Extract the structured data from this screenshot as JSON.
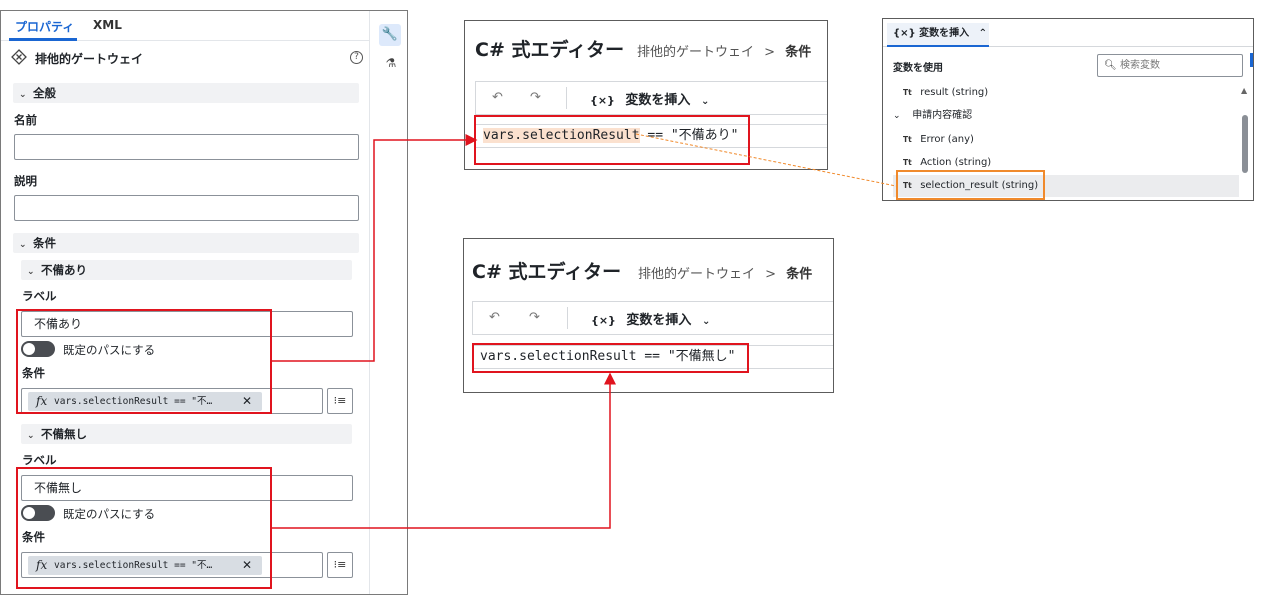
{
  "properties_panel": {
    "tabs": [
      "プロパティ",
      "XML"
    ],
    "gateway_title": "排他的ゲートウェイ",
    "help_icon": "question-circle-icon",
    "sections": {
      "general": "全般",
      "conditions": "条件"
    },
    "fields": {
      "name_label": "名前",
      "name_value": "",
      "description_label": "説明",
      "description_value": ""
    },
    "branches": [
      {
        "title": "不備あり",
        "label_caption": "ラベル",
        "label_value": "不備あり",
        "default_path_label": "既定のパスにする",
        "condition_caption": "条件",
        "condition_text": "vars.selectionResult == \"不…",
        "fx": "fx"
      },
      {
        "title": "不備無し",
        "label_caption": "ラベル",
        "label_value": "不備無し",
        "default_path_label": "既定のパスにする",
        "condition_caption": "条件",
        "condition_text": "vars.selectionResult == \"不…",
        "fx": "fx"
      }
    ],
    "side_icons": [
      "wrench-icon",
      "flask-icon"
    ]
  },
  "editor_top": {
    "title": "C# 式エディター",
    "breadcrumb_parent": "排他的ゲートウェイ",
    "breadcrumb_separator": ">",
    "breadcrumb_current": "条件",
    "insert_label": "変数を挿入",
    "insert_prefix": "{×}",
    "code_var": "vars.selectionResult",
    "code_rest": " == \"不備あり\""
  },
  "editor_bottom": {
    "title": "C# 式エディター",
    "breadcrumb_parent": "排他的ゲートウェイ",
    "breadcrumb_separator": ">",
    "breadcrumb_current": "条件",
    "insert_label": "変数を挿入",
    "insert_prefix": "{×}",
    "code": "vars.selectionResult == \"不備無し\""
  },
  "variable_picker": {
    "tab_label": "{×}  変数を挿入",
    "use_label": "変数を使用",
    "search_placeholder": "検索変数",
    "items": [
      {
        "type_badge": "Tt",
        "name": "result (string)"
      },
      {
        "group": "申請内容確認"
      },
      {
        "type_badge": "Tt",
        "name": "Error (any)"
      },
      {
        "type_badge": "Tt",
        "name": "Action (string)"
      },
      {
        "type_badge": "Tt",
        "name": "selection_result (string)"
      }
    ]
  },
  "colors": {
    "accent": "#1a66d2",
    "highlight_box": "#e0141e",
    "picker_highlight": "#f08a2c"
  }
}
